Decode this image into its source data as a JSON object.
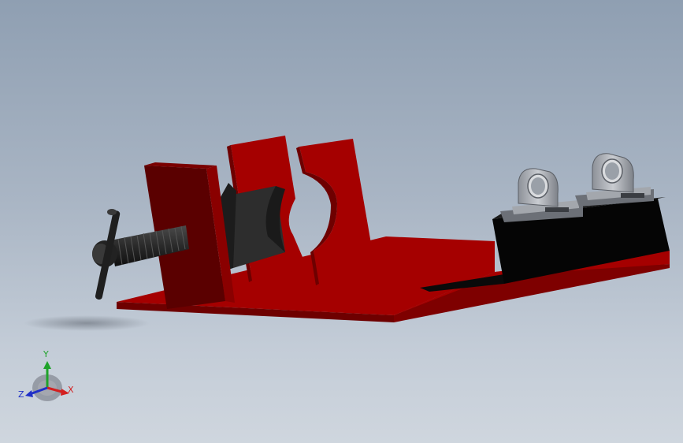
{
  "triad": {
    "x_label": "X",
    "y_label": "Y",
    "z_label": "Z",
    "x_color": "#d32020",
    "y_color": "#1fa32a",
    "z_color": "#2030c8"
  },
  "colors": {
    "background_top": "#8f9fb2",
    "background_bottom": "#cfd6de",
    "base_plate": "#a50000",
    "part_dark": "#5a0000",
    "screw": "#2a2a2a",
    "bearing": "#a9adb4",
    "black_block": "#050505"
  },
  "icons": {
    "triad": "coordinate-triad-icon"
  }
}
